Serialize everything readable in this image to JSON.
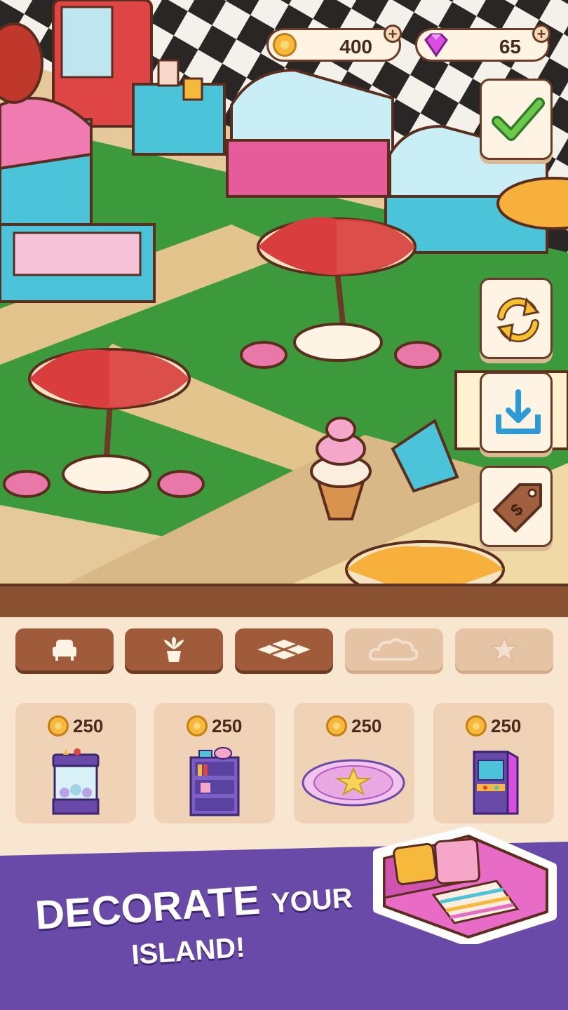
{
  "hud": {
    "coins": "400",
    "gems": "65",
    "plus": "+"
  },
  "side_buttons": [
    "confirm-check-icon",
    "rotate-icon",
    "store-icon",
    "sell-tag-icon"
  ],
  "tabs": [
    {
      "icon": "armchair-icon",
      "state": "active"
    },
    {
      "icon": "plant-icon",
      "state": "active"
    },
    {
      "icon": "floor-tile-icon",
      "state": "active"
    },
    {
      "icon": "cloud-icon",
      "state": "inactive"
    },
    {
      "icon": "star-icon",
      "state": "inactive"
    }
  ],
  "items": [
    {
      "price": "250",
      "icon": "claw-machine-icon"
    },
    {
      "price": "250",
      "icon": "bookshelf-icon"
    },
    {
      "price": "250",
      "icon": "star-rug-icon"
    },
    {
      "price": "250",
      "icon": "arcade-cabinet-icon"
    }
  ],
  "banner": {
    "line1_big": "DECORATE",
    "line1_small": "YOUR",
    "line2": "ISLAND!"
  },
  "colors": {
    "accent_brown": "#a05b3a",
    "banner_purple": "#6a4aa8",
    "panel_cream": "#f8e6d0",
    "coin_gold": "#f6b93b",
    "gem_pink": "#d94ee0"
  }
}
